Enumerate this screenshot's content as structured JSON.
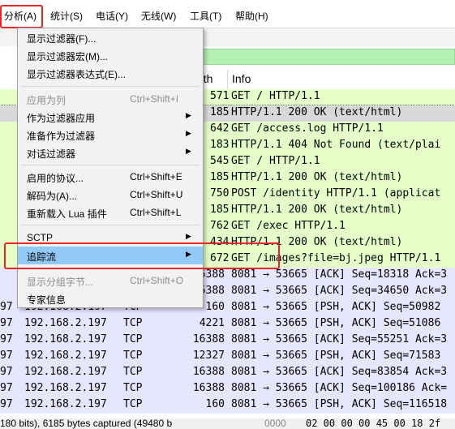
{
  "menubar": [
    "分析(A)",
    "统计(S)",
    "电话(Y)",
    "无线(W)",
    "工具(T)",
    "帮助(H)"
  ],
  "columns": {
    "length_partial": "gth",
    "info": "Info"
  },
  "http_rows": [
    {
      "len": "571",
      "info": "GET / HTTP/1.1"
    },
    {
      "len": "185",
      "info": "HTTP/1.1 200 OK  (text/html)"
    },
    {
      "len": "642",
      "info": "GET /access.log HTTP/1.1"
    },
    {
      "len": "183",
      "info": "HTTP/1.1 404 Not Found  (text/plai"
    },
    {
      "len": "545",
      "info": "GET / HTTP/1.1"
    },
    {
      "len": "185",
      "info": "HTTP/1.1 200 OK  (text/html)"
    },
    {
      "len": "750",
      "info": "POST /identity HTTP/1.1  (applicat"
    },
    {
      "len": "185",
      "info": "HTTP/1.1 200 OK  (text/html)"
    },
    {
      "len": "762",
      "info": "GET /exec HTTP/1.1"
    },
    {
      "len": "434",
      "info": "HTTP/1.1 200 OK  (text/html)"
    },
    {
      "len": "672",
      "info": "GET /images?file=bj.jpeg HTTP/1.1"
    }
  ],
  "tcp_rows": [
    {
      "no": "",
      "src": "",
      "proto": "",
      "len": "16388",
      "info": "8081 → 53665 [ACK] Seq=18318 Ack=3"
    },
    {
      "no": "",
      "src": "",
      "proto": "",
      "len": "16388",
      "info": "8081 → 53665 [ACK] Seq=34650 Ack=3"
    },
    {
      "no": "97",
      "src": "192.168.2.197",
      "proto": "TCP",
      "len": "160",
      "info": "8081 → 53665 [PSH, ACK] Seq=50982"
    },
    {
      "no": "97",
      "src": "192.168.2.197",
      "proto": "TCP",
      "len": "4221",
      "info": "8081 → 53665 [PSH, ACK] Seq=51086"
    },
    {
      "no": "97",
      "src": "192.168.2.197",
      "proto": "TCP",
      "len": "16388",
      "info": "8081 → 53665 [ACK] Seq=55251 Ack=3"
    },
    {
      "no": "97",
      "src": "192.168.2.197",
      "proto": "TCP",
      "len": "12327",
      "info": "8081 → 53665 [PSH, ACK] Seq=71583"
    },
    {
      "no": "97",
      "src": "192.168.2.197",
      "proto": "TCP",
      "len": "16388",
      "info": "8081 → 53665 [ACK] Seq=83854 Ack=3"
    },
    {
      "no": "97",
      "src": "192.168.2.197",
      "proto": "TCP",
      "len": "16388",
      "info": "8081 → 53665 [ACK] Seq=100186 Ack="
    },
    {
      "no": "97",
      "src": "192.168.2.197",
      "proto": "TCP",
      "len": "160",
      "info": "8081 → 53665 [PSH, ACK] Seq=116518"
    }
  ],
  "status": {
    "frame_summary": "180 bits), 6185 bytes captured (49480 b",
    "hex_offset": "0000",
    "hex_bytes": "02 00 00 00 45 00 18 2f"
  },
  "menu": {
    "display_filters": "显示过滤器(F)...",
    "display_filter_macros": "显示过滤器宏(M)...",
    "display_filter_expression": "显示过滤器表达式(E)...",
    "apply_as_column": "应用为列",
    "apply_as_column_shortcut": "Ctrl+Shift+I",
    "apply_as_filter": "作为过滤器应用",
    "prepare_as_filter": "准备作为过滤器",
    "conversation_filter": "对话过滤器",
    "enabled_protocols": "启用的协议...",
    "enabled_protocols_shortcut": "Ctrl+Shift+E",
    "decode_as": "解码为(A)...",
    "decode_as_shortcut": "Ctrl+Shift+U",
    "reload_lua": "重新载入 Lua 插件",
    "reload_lua_shortcut": "Ctrl+Shift+L",
    "sctp": "SCTP",
    "follow_stream": "追踪流",
    "show_packet_bytes": "显示分组字节...",
    "show_packet_bytes_shortcut": "Ctrl+Shift+O",
    "expert_info": "专家信息"
  }
}
